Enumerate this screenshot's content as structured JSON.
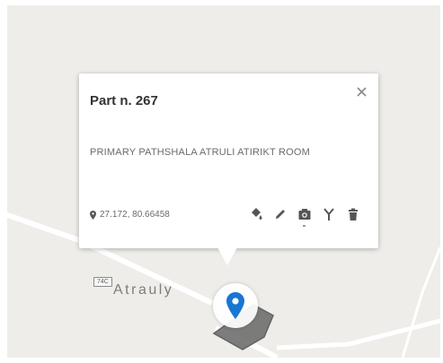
{
  "popup": {
    "title": "Part n. 267",
    "description": "PRIMARY PATHSHALA ATRULI ATIRIKT ROOM",
    "coordinates": "27.172, 80.66458"
  },
  "map": {
    "place_label": "Atrauly",
    "road_shield": "74C",
    "marker_color": "#1976d2",
    "parcel_color": "#6f6f6f"
  },
  "icons": {
    "close": "close-icon",
    "location": "location-pin-icon",
    "fill": "paint-bucket-icon",
    "edit": "pencil-icon",
    "photo": "camera-icon",
    "split": "fork-icon",
    "delete": "trash-icon"
  }
}
